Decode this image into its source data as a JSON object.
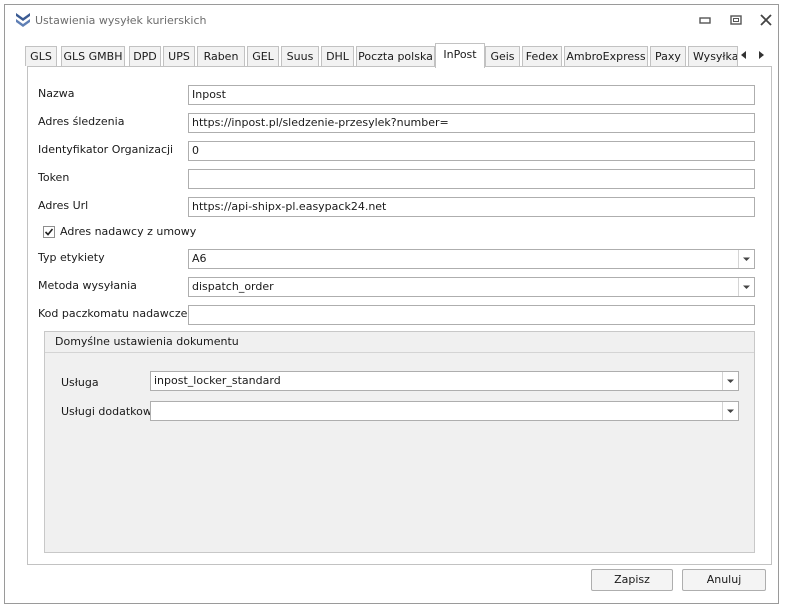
{
  "window": {
    "title": "Ustawienia wysyłek kurierskich"
  },
  "tabs": [
    {
      "label": "GLS"
    },
    {
      "label": "GLS GMBH"
    },
    {
      "label": "DPD"
    },
    {
      "label": "UPS"
    },
    {
      "label": "Raben"
    },
    {
      "label": "GEL"
    },
    {
      "label": "Suus"
    },
    {
      "label": "DHL"
    },
    {
      "label": "Poczta polska"
    },
    {
      "label": "InPost"
    },
    {
      "label": "Geis"
    },
    {
      "label": "Fedex"
    },
    {
      "label": "AmbroExpress"
    },
    {
      "label": "Paxy"
    },
    {
      "label": "Wysyłka"
    }
  ],
  "active_tab": "InPost",
  "form": {
    "nazwa": {
      "label": "Nazwa",
      "value": "Inpost"
    },
    "adres_sledzenia": {
      "label": "Adres śledzenia",
      "value": "https://inpost.pl/sledzenie-przesylek?number="
    },
    "identyfikator": {
      "label": "Identyfikator Organizacji",
      "value": "0"
    },
    "token": {
      "label": "Token",
      "value": ""
    },
    "adres_url": {
      "label": "Adres Url",
      "value": "https://api-shipx-pl.easypack24.net"
    },
    "adres_nadawcy": {
      "label": "Adres nadawcy z umowy",
      "checked": true
    },
    "typ_etykiety": {
      "label": "Typ etykiety",
      "value": "A6"
    },
    "metoda_wysylania": {
      "label": "Metoda wysyłania",
      "value": "dispatch_order"
    },
    "kod_paczkomatu": {
      "label": "Kod paczkomatu nadawczego",
      "value": ""
    }
  },
  "group": {
    "title": "Domyślne ustawienia dokumentu",
    "usluga": {
      "label": "Usługa",
      "value": "inpost_locker_standard"
    },
    "uslugi_dodatkowe": {
      "label": "Usługi dodatkowe",
      "value": ""
    }
  },
  "buttons": {
    "save": "Zapisz",
    "cancel": "Anuluj"
  },
  "colors": {
    "window_border": "#9a9a9a",
    "group_bg": "#f0f0f0",
    "input_border": "#aeaeae",
    "icon_blue": "#3b5b93"
  }
}
